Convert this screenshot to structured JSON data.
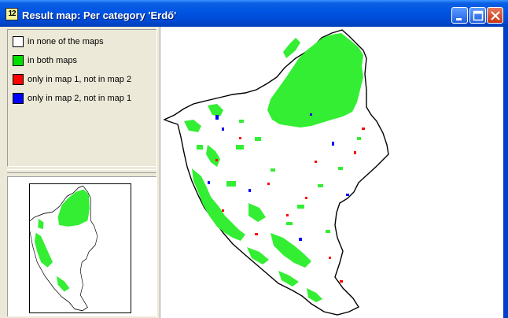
{
  "window": {
    "title": "Result map: Per category 'Erdő'",
    "icon_glyph": "12"
  },
  "controls": {
    "minimize_icon": "minimize-icon",
    "maximize_icon": "maximize-icon",
    "close_icon": "close-icon"
  },
  "legend": {
    "items": [
      {
        "label": "in none of the maps",
        "color": "#ffffff"
      },
      {
        "label": "in both maps",
        "color": "#00e000"
      },
      {
        "label": "only in map 1, not in map 2",
        "color": "#ff0000"
      },
      {
        "label": "only in map 2, not in map 1",
        "color": "#0000ff"
      }
    ]
  },
  "colors": {
    "titlebar": "#0054e3",
    "window_bg": "#ece9d8",
    "both": "#33ee33",
    "map1_only": "#ff0000",
    "map2_only": "#0000ff"
  }
}
